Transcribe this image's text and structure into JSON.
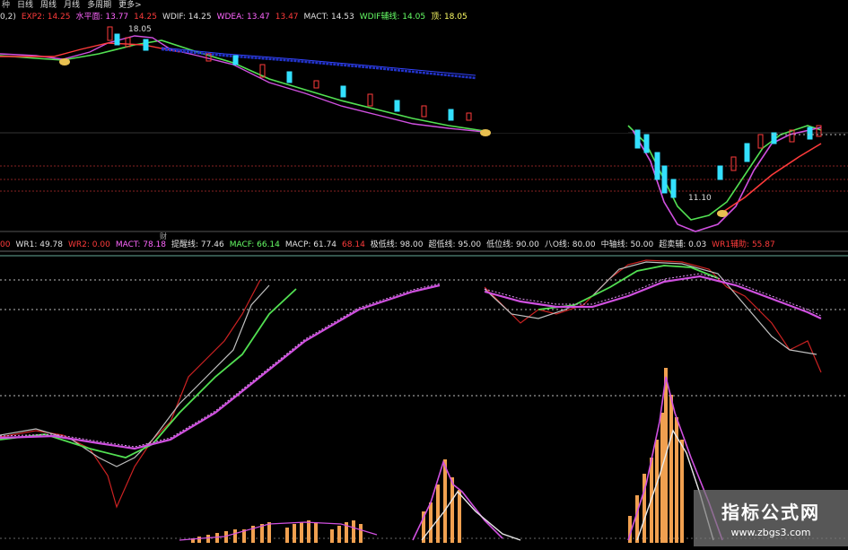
{
  "tabs": [
    "种",
    "日线",
    "周线",
    "月线",
    "多周期",
    "更多>"
  ],
  "legend_top": {
    "prefix": "0,2)",
    "items": [
      {
        "text": "EXP2: 14.25",
        "color": "#ff3b3b"
      },
      {
        "text": "水平面: 13.77",
        "color": "#ff66ff"
      },
      {
        "text": "14.25",
        "color": "#ff3b3b"
      },
      {
        "text": "WDIF: 14.25",
        "color": "#e0e0e0"
      },
      {
        "text": "WDEA: 13.47",
        "color": "#ff66ff"
      },
      {
        "text": "13.47",
        "color": "#ff3b3b"
      },
      {
        "text": "MACT: 14.53",
        "color": "#e0e0e0"
      },
      {
        "text": "WDIF辅线: 14.05",
        "color": "#66ff66"
      },
      {
        "text": "顶: 18.05",
        "color": "#ffff66"
      }
    ]
  },
  "legend_bottom": {
    "items": [
      {
        "text": "00",
        "color": "#ff3b3b"
      },
      {
        "text": "WR1: 49.78",
        "color": "#e0e0e0"
      },
      {
        "text": "WR2: 0.00",
        "color": "#ff3b3b"
      },
      {
        "text": "MACT: 78.18",
        "color": "#ff66ff"
      },
      {
        "text": "提醒线: 77.46",
        "color": "#e0e0e0"
      },
      {
        "text": "MACF: 66.14",
        "color": "#66ff66"
      },
      {
        "text": "MACP: 61.74",
        "color": "#e0e0e0"
      },
      {
        "text": "68.14",
        "color": "#ff3b3b"
      },
      {
        "text": "极低线: 98.00",
        "color": "#e0e0e0"
      },
      {
        "text": "超低线: 95.00",
        "color": "#e0e0e0"
      },
      {
        "text": "低位线: 90.00",
        "color": "#e0e0e0"
      },
      {
        "text": "八O线: 80.00",
        "color": "#e0e0e0"
      },
      {
        "text": "中轴线: 50.00",
        "color": "#e0e0e0"
      },
      {
        "text": "超卖辅: 0.03",
        "color": "#e0e0e0"
      },
      {
        "text": "WR1辅助: 55.87",
        "color": "#ff3b3b"
      }
    ]
  },
  "price_labels": {
    "high": "18.05",
    "low": "11.10"
  },
  "separator_label": "财",
  "watermark": {
    "title": "指标公式网",
    "url": "www.zbgs3.com"
  },
  "colors": {
    "background": "#000000",
    "up": "#ff3b3b",
    "down": "#33e0ff",
    "green_line": "#52e052",
    "magenta_line": "#d050e0",
    "white_line": "#e0e0e0",
    "bar": "#f0a050"
  }
}
